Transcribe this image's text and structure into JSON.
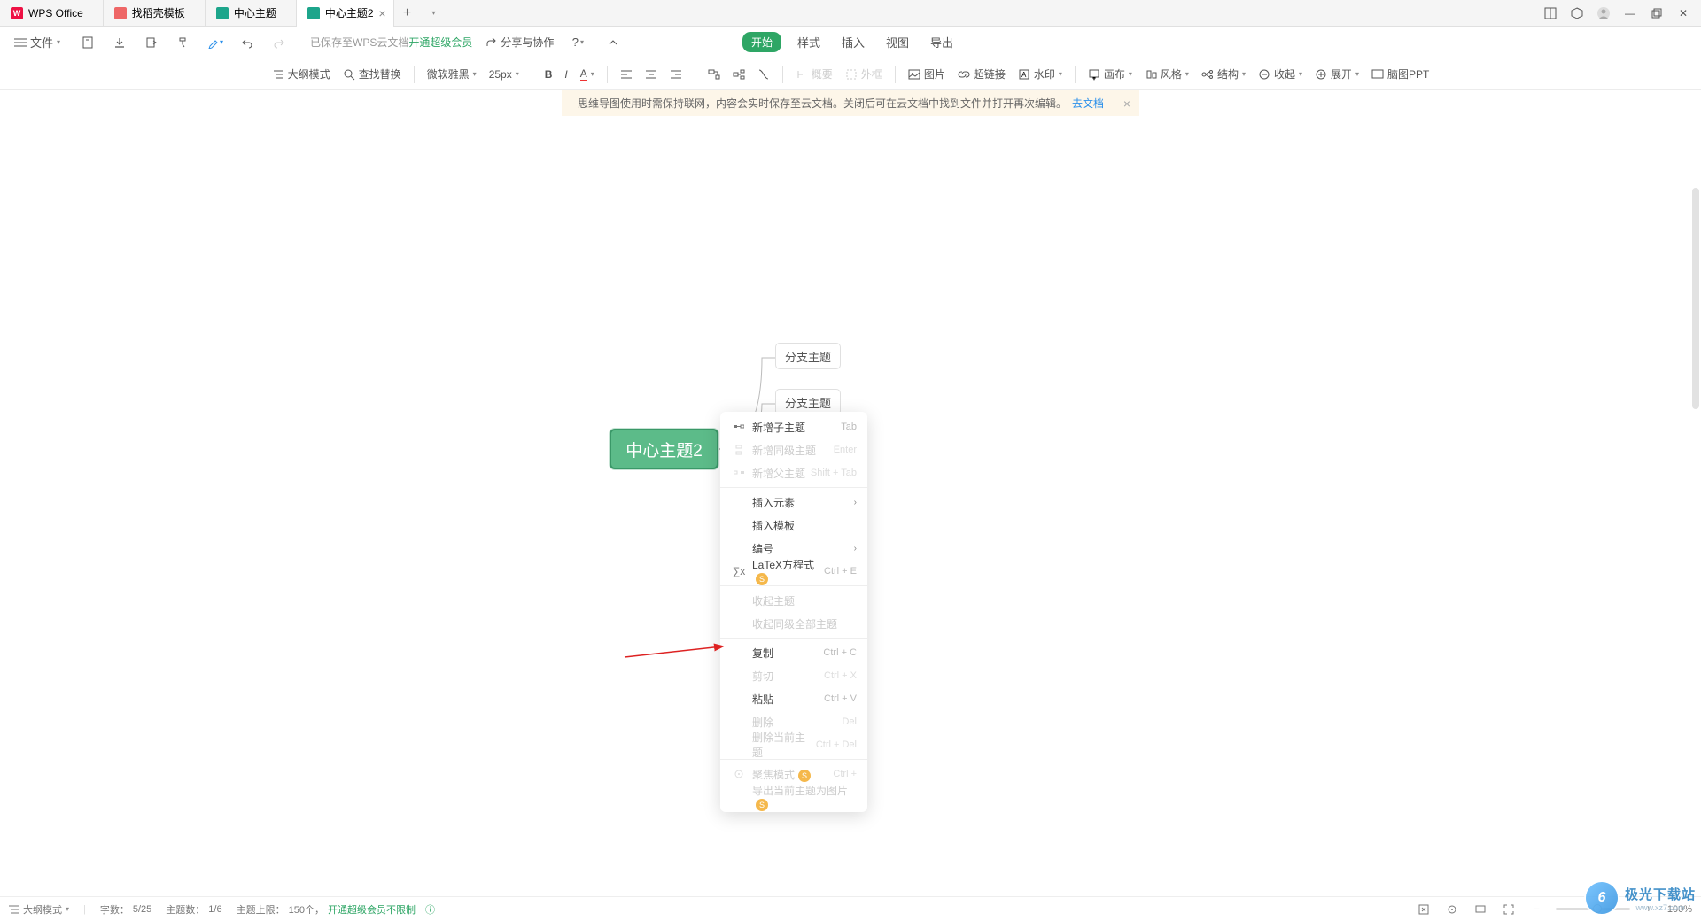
{
  "tabs": [
    {
      "label": "WPS Office",
      "icon": "wps"
    },
    {
      "label": "找稻壳模板",
      "icon": "orange"
    },
    {
      "label": "中心主题",
      "icon": "teal"
    },
    {
      "label": "中心主题2",
      "icon": "teal",
      "active": true
    }
  ],
  "file_menu": {
    "label": "文件"
  },
  "saved_status": "已保存至WPS云文档",
  "ribbon": {
    "start": "开始",
    "format": "样式",
    "insert": "插入",
    "view": "视图",
    "export": "导出"
  },
  "premium_link": "开通超级会员",
  "share_label": "分享与协作",
  "toolbar": {
    "outline": "大纲模式",
    "find": "查找替换",
    "font": "微软雅黑",
    "size": "25px",
    "summary": "概要",
    "frame": "外框",
    "image": "图片",
    "link": "超链接",
    "watermark": "水印",
    "canvas": "画布",
    "style": "风格",
    "structure": "结构",
    "fold": "收起",
    "expand": "展开",
    "ppt": "脑图PPT"
  },
  "notice": {
    "text": "思维导图使用时需保持联网，内容会实时保存至云文档。关闭后可在云文档中找到文件并打开再次编辑。",
    "link": "去文档"
  },
  "central_node": "中心主题2",
  "branch_nodes": [
    "分支主题",
    "分支主题"
  ],
  "ctx": {
    "new_child": {
      "label": "新增子主题",
      "key": "Tab"
    },
    "new_sibling": {
      "label": "新增同级主题",
      "key": "Enter"
    },
    "new_parent": {
      "label": "新增父主题",
      "key": "Shift + Tab"
    },
    "insert_element": "插入元素",
    "insert_template": "插入模板",
    "numbering": "编号",
    "latex": {
      "label": "LaTeX方程式",
      "key": "Ctrl + E"
    },
    "fold_topic": "收起主题",
    "fold_siblings": "收起同级全部主题",
    "copy": {
      "label": "复制",
      "key": "Ctrl + C"
    },
    "cut": {
      "label": "剪切",
      "key": "Ctrl + X"
    },
    "paste": {
      "label": "粘贴",
      "key": "Ctrl + V"
    },
    "delete": {
      "label": "删除",
      "key": "Del"
    },
    "delete_current": {
      "label": "删除当前主题",
      "key": "Ctrl + Del"
    },
    "focus": {
      "label": "聚焦模式",
      "key": "Ctrl +"
    },
    "export_img": "导出当前主题为图片"
  },
  "status": {
    "outline": "大纲模式",
    "words_label": "字数：",
    "words": "5/25",
    "topics_label": "主题数：",
    "topics": "1/6",
    "limit_label": "主题上限：",
    "limit": "150个，",
    "upgrade": "开通超级会员不限制",
    "zoom": "100%"
  },
  "watermark": {
    "cn": "极光下载站",
    "url": "www.xz7.com",
    "icon": "6"
  }
}
